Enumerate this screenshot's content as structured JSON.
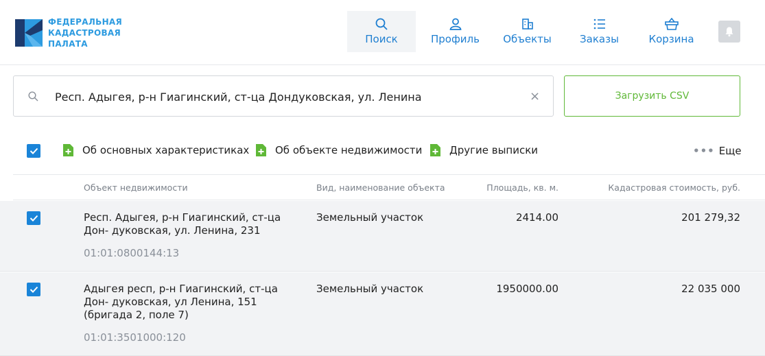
{
  "header": {
    "logo_text": "ФЕДЕРАЛЬНАЯ КАДАСТРОВАЯ ПАЛАТА",
    "nav": [
      {
        "label": "Поиск",
        "icon": "search-icon",
        "active": true
      },
      {
        "label": "Профиль",
        "icon": "user-icon"
      },
      {
        "label": "Объекты",
        "icon": "buildings-icon"
      },
      {
        "label": "Заказы",
        "icon": "list-icon"
      },
      {
        "label": "Корзина",
        "icon": "basket-icon"
      }
    ]
  },
  "search": {
    "value": "Респ. Адыгея, р-н Гиагинский, ст-ца Дондуковская, ул. Ленина",
    "clear": "×"
  },
  "upload_button": "Загрузить CSV",
  "toolbar": {
    "items": [
      "Об основных характеристиках",
      "Об объекте недвижимости",
      "Другие выписки"
    ],
    "more": "Еще",
    "more_dots": "•••"
  },
  "table": {
    "columns": [
      "Объект недвижимости",
      "Вид, наименование объекта",
      "Площадь, кв. м.",
      "Кадастровая стоимость, руб."
    ],
    "rows": [
      {
        "address": "Респ. Адыгея, р-н Гиагинский, ст-ца Дон- дуковская, ул. Ленина, 231",
        "cadastral": "01:01:0800144:13",
        "kind": "Земельный участок",
        "area": "2414.00",
        "cost": "201 279,32",
        "checked": true
      },
      {
        "address": "Адыгея респ, р-н Гиагинский, ст-ца Дон- дуковская, ул Ленина, 151 (бригада 2, поле 7)",
        "cadastral": "01:01:3501000:120",
        "kind": "Земельный участок",
        "area": "1950000.00",
        "cost": "22 035 000",
        "checked": true
      }
    ]
  },
  "colors": {
    "accent": "#1a84d8",
    "nav": "#1f7fd1",
    "green": "#5fb837",
    "row_bg": "#f2f3f5"
  }
}
